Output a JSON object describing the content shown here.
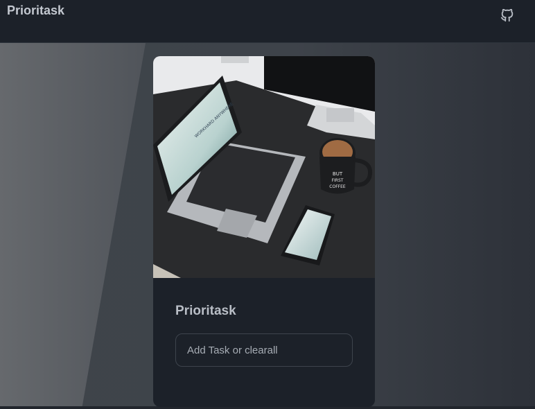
{
  "navbar": {
    "brand": "Prioritask",
    "github_icon": "github-icon"
  },
  "card": {
    "title": "Prioritask",
    "input_placeholder": "Add Task or clearall",
    "input_value": "",
    "image_desc_icon": "workspace-photo"
  },
  "photo_text": {
    "laptop_screen": "WORKHARD ANYWHERE",
    "mug": "BUT FIRST COFFEE"
  },
  "colors": {
    "navbar_bg": "#1c2129",
    "card_bg": "#1c2129",
    "brand_text": "#c3c8d0",
    "input_border": "#3e444d"
  }
}
